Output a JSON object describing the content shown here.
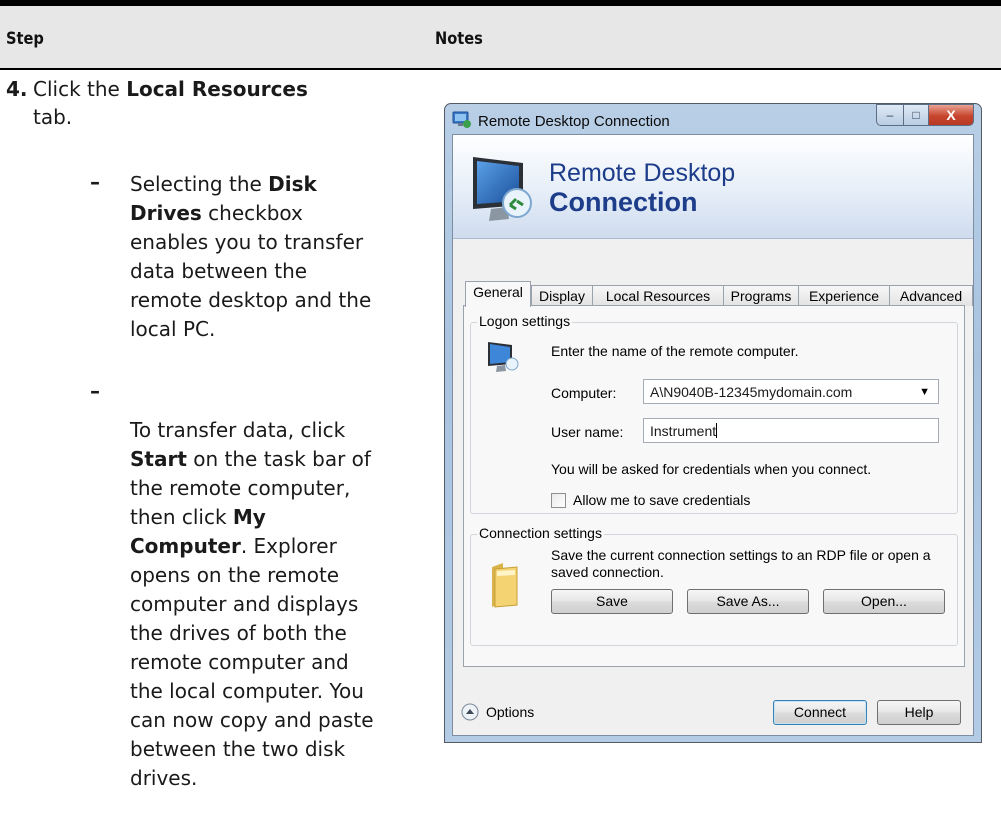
{
  "table": {
    "header": {
      "step": "Step",
      "notes": "Notes"
    }
  },
  "step": {
    "number": "4.",
    "line1_pre": "Click the ",
    "line1_bold": "Local Resources",
    "line2": "tab."
  },
  "bullets": {
    "dash": "–",
    "b1": {
      "l1_pre": "Selecting the ",
      "l1_bold": "Disk",
      "l2_bold": "Drives",
      "l2_post": " checkbox",
      "l3": "enables you to transfer",
      "l4": "data between the",
      "l5": "remote desktop and the",
      "l6": "local PC."
    },
    "b2": {
      "l1": "To transfer data, click",
      "l2_bold": "Start",
      "l2_post": " on the task bar of",
      "l3": "the remote computer,",
      "l4_pre": "then click ",
      "l4_bold": "My",
      "l5_bold": "Computer",
      "l5_post": ". Explorer",
      "l6": "opens on the remote",
      "l7": "computer and displays",
      "l8": "the drives of both the",
      "l9": "remote computer and",
      "l10": "the local computer. You",
      "l11": "can now copy and paste",
      "l12": "between the two disk",
      "l13": "drives."
    }
  },
  "dialog": {
    "title": "Remote Desktop Connection",
    "window_buttons": {
      "minimize": "–",
      "maximize": "□",
      "close": "X"
    },
    "banner": {
      "line1": "Remote Desktop",
      "line2": "Connection"
    },
    "tabs": [
      "General",
      "Display",
      "Local Resources",
      "Programs",
      "Experience",
      "Advanced"
    ],
    "active_tab": "General",
    "logon": {
      "group_label": "Logon settings",
      "instruction": "Enter the name of the remote computer.",
      "computer_label": "Computer:",
      "computer_value": "A\\N9040B-12345mydomain.com",
      "username_label": "User name:",
      "username_value": "Instrument",
      "credentials_note": "You will be asked for credentials when you connect.",
      "save_credentials_label": "Allow me to save credentials",
      "save_credentials_checked": false
    },
    "connection": {
      "group_label": "Connection settings",
      "desc_line1": "Save the current connection settings to an RDP file or open a",
      "desc_line2": "saved connection.",
      "save_button": "Save",
      "save_as_button": "Save As...",
      "open_button": "Open..."
    },
    "footer": {
      "options_label": "Options",
      "connect_button": "Connect",
      "help_button": "Help"
    }
  },
  "colors": {
    "header_band": "#e7e7e7",
    "window_frame": "#b3cbe4",
    "banner_text": "#1d3c8a",
    "close_button": "#c7452e"
  },
  "icons": [
    "rdp-app-icon",
    "remote-computer-icon",
    "folder-icon",
    "options-chevron-icon",
    "dropdown-arrow-icon"
  ]
}
